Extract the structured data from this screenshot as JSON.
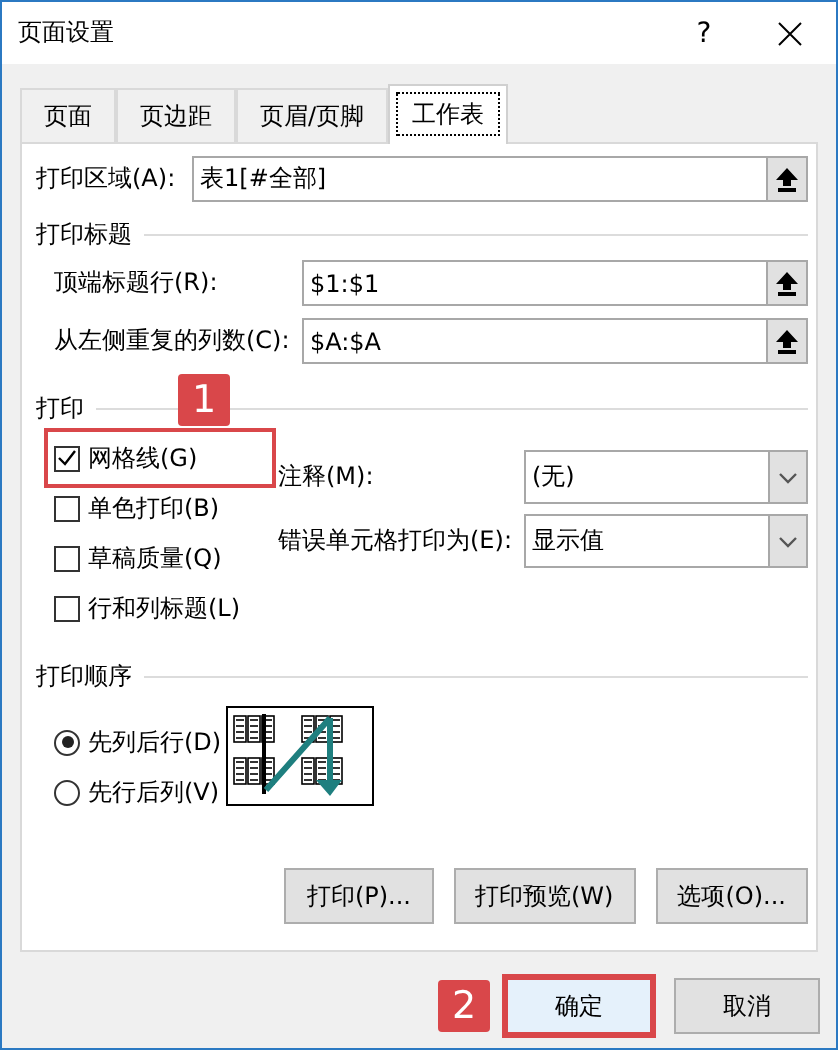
{
  "window": {
    "title": "页面设置",
    "help_button": "?"
  },
  "tabs": [
    {
      "label": "页面",
      "selected": false
    },
    {
      "label": "页边距",
      "selected": false
    },
    {
      "label": "页眉/页脚",
      "selected": false
    },
    {
      "label": "工作表",
      "selected": true
    }
  ],
  "print_area": {
    "label": "打印区域(A):",
    "value": "表1[#全部]"
  },
  "print_titles": {
    "heading": "打印标题",
    "rows": [
      {
        "label": "顶端标题行(R):",
        "value": "$1:$1"
      },
      {
        "label": "从左侧重复的列数(C):",
        "value": "$A:$A"
      }
    ]
  },
  "print": {
    "heading": "打印",
    "checkboxes": [
      {
        "label": "网格线(G)",
        "checked": true,
        "highlighted": true,
        "callout": "1"
      },
      {
        "label": "单色打印(B)",
        "checked": false,
        "highlighted": false
      },
      {
        "label": "草稿质量(Q)",
        "checked": false,
        "highlighted": false
      },
      {
        "label": "行和列标题(L)",
        "checked": false,
        "highlighted": false
      }
    ],
    "dropdowns": [
      {
        "label": "注释(M):",
        "value": "(无)"
      },
      {
        "label": "错误单元格打印为(E):",
        "value": "显示值"
      }
    ]
  },
  "print_order": {
    "heading": "打印顺序",
    "options": [
      {
        "label": "先列后行(D)",
        "selected": true
      },
      {
        "label": "先行后列(V)",
        "selected": false
      }
    ]
  },
  "panel_buttons": [
    "打印(P)...",
    "打印预览(W)",
    "选项(O)..."
  ],
  "footer_buttons": [
    {
      "label": "确定",
      "default": true,
      "highlighted": true,
      "callout": "2"
    },
    {
      "label": "取消",
      "default": false,
      "highlighted": false
    }
  ]
}
